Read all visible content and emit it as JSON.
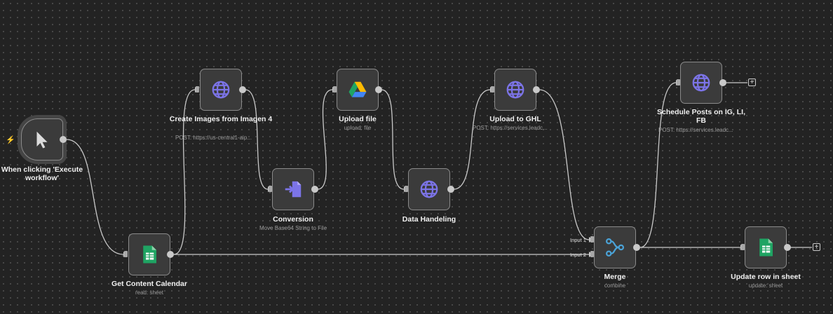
{
  "colors": {
    "accent": "#7c74e8",
    "sheets_green": "#1fa463",
    "wire": "#c9c9c9",
    "trigger_bolt": "#ff5a43",
    "merge_icon": "#4aa3d8"
  },
  "nodes": {
    "trigger": {
      "label": "When clicking 'Execute workflow'",
      "icon": "cursor-icon"
    },
    "get_calendar": {
      "label": "Get Content Calendar",
      "sub": "read: sheet",
      "icon": "google-sheets-icon"
    },
    "create_images": {
      "label": "Create Images from Imagen 4",
      "sub": "POST: https://us-central1-aip...",
      "icon": "globe-icon"
    },
    "conversion": {
      "label": "Conversion",
      "sub": "Move Base64 String to File",
      "icon": "convert-file-icon"
    },
    "upload_file": {
      "label": "Upload file",
      "sub": "upload: file",
      "icon": "google-drive-icon"
    },
    "data_handeling": {
      "label": "Data Handeling",
      "icon": "globe-icon"
    },
    "upload_ghl": {
      "label": "Upload to GHL",
      "sub": "POST: https://services.leadc...",
      "icon": "globe-icon"
    },
    "schedule_posts": {
      "label": "Schedule Posts on IG, LI, FB",
      "sub": "POST: https://services.leadc...",
      "icon": "globe-icon"
    },
    "merge": {
      "label": "Merge",
      "sub": "combine",
      "input1": "Input 1",
      "input2": "Input 2",
      "icon": "merge-icon"
    },
    "update_row": {
      "label": "Update row in sheet",
      "sub": "update: sheet",
      "icon": "google-sheets-icon"
    }
  },
  "add_button": "+"
}
